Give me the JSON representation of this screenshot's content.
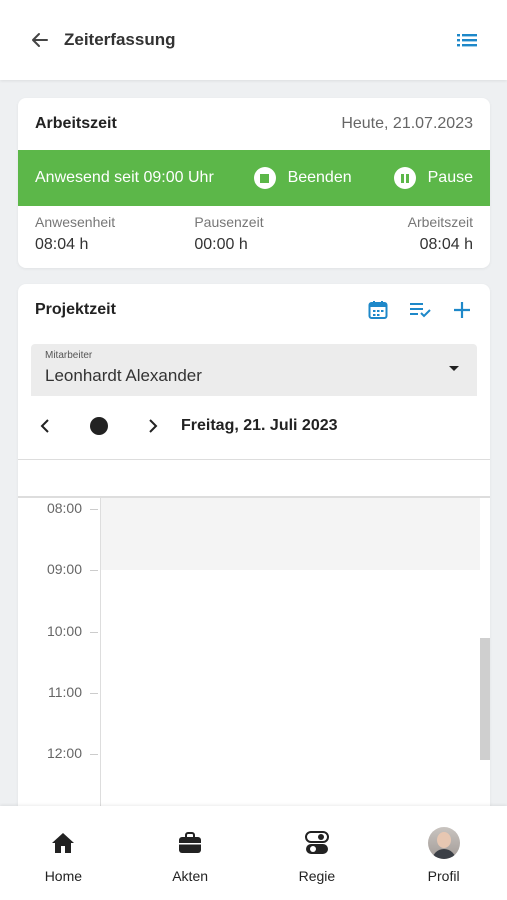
{
  "appbar": {
    "title": "Zeiterfassung",
    "back_icon": "arrow-left-icon",
    "menu_icon": "list-icon"
  },
  "worktime": {
    "title": "Arbeitszeit",
    "date": "Heute, 21.07.2023",
    "status": "Anwesend seit 09:00 Uhr",
    "stop_label": "Beenden",
    "pause_label": "Pause",
    "stats": [
      {
        "label": "Anwesenheit",
        "value": "08:04 h"
      },
      {
        "label": "Pausenzeit",
        "value": "00:00 h"
      },
      {
        "label": "Arbeitszeit",
        "value": "08:04 h"
      }
    ],
    "accent": "#5cb749"
  },
  "project": {
    "title": "Projektzeit",
    "icons": [
      "calendar-icon",
      "checklist-icon",
      "add-icon"
    ],
    "employee_label": "Mitarbeiter",
    "employee_value": "Leonhardt Alexander",
    "date_label": "Freitag, 21. Juli 2023",
    "hours": [
      "08:00",
      "09:00",
      "10:00",
      "11:00",
      "12:00"
    ],
    "accent": "#1e88c9"
  },
  "bottomnav": {
    "items": [
      {
        "label": "Home",
        "icon": "home-icon"
      },
      {
        "label": "Akten",
        "icon": "briefcase-icon"
      },
      {
        "label": "Regie",
        "icon": "toggle-icon"
      },
      {
        "label": "Profil",
        "icon": "avatar"
      }
    ]
  }
}
